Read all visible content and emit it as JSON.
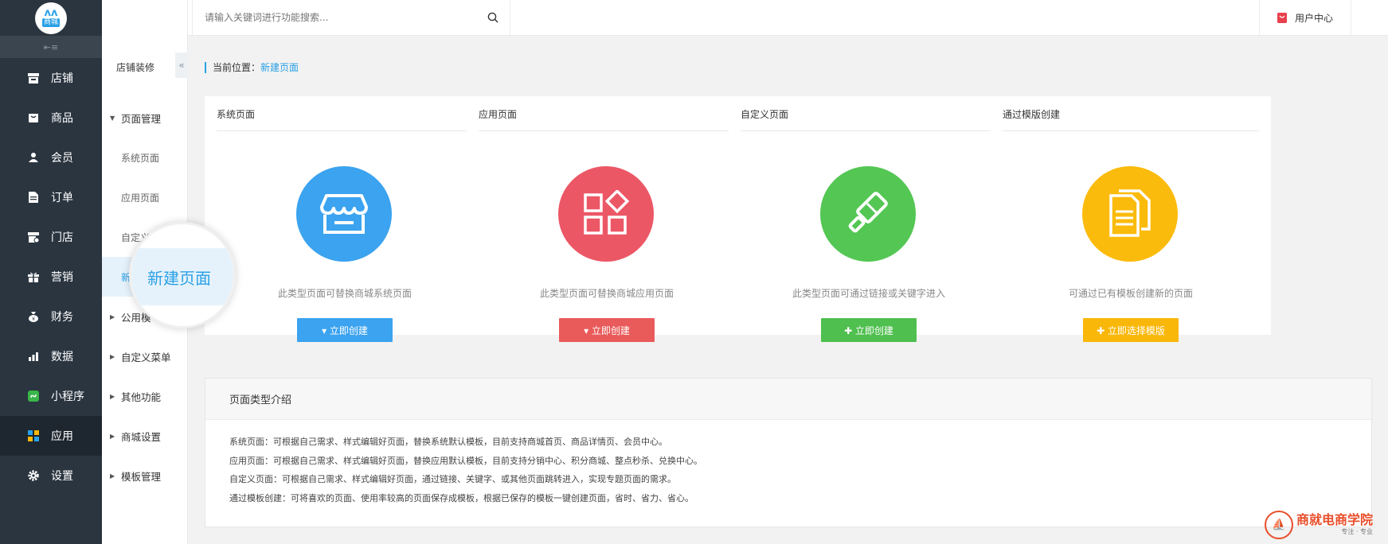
{
  "logo": {
    "mark": "ʌʌ",
    "text": "商城"
  },
  "sidebar": {
    "items": [
      {
        "label": "店铺",
        "icon": "store-icon"
      },
      {
        "label": "商品",
        "icon": "bag-icon"
      },
      {
        "label": "会员",
        "icon": "user-icon"
      },
      {
        "label": "订单",
        "icon": "document-icon"
      },
      {
        "label": "门店",
        "icon": "shop-icon"
      },
      {
        "label": "营销",
        "icon": "gift-icon"
      },
      {
        "label": "财务",
        "icon": "money-bag-icon"
      },
      {
        "label": "数据",
        "icon": "chart-icon"
      },
      {
        "label": "小程序",
        "icon": "miniprogram-icon"
      },
      {
        "label": "应用",
        "icon": "apps-icon",
        "active": true
      },
      {
        "label": "设置",
        "icon": "gear-icon"
      }
    ]
  },
  "subnav": {
    "title": "店铺装修",
    "page_management": "页面管理",
    "items": [
      "系统页面",
      "应用页面",
      "自定义",
      "新"
    ],
    "public": "公用模",
    "custom_menu": "自定义菜单",
    "other": "其他功能",
    "mall_settings": "商城设置",
    "template_mgmt": "模板管理"
  },
  "magnifier_text": "新建页面",
  "topbar": {
    "search_placeholder": "请输入关键词进行功能搜索...",
    "user_center": "用户中心"
  },
  "breadcrumb": {
    "prefix": "当前位置：",
    "current": "新建页面"
  },
  "cards": [
    {
      "title": "系统页面",
      "desc": "此类型页面可替换商城系统页面",
      "button": "▾ 立即创建",
      "color": "#3ba3ef",
      "btn_color": "#3ba3ef"
    },
    {
      "title": "应用页面",
      "desc": "此类型页面可替换商城应用页面",
      "button": "▾ 立即创建",
      "color": "#ec5766",
      "btn_color": "#e95a5a"
    },
    {
      "title": "自定义页面",
      "desc": "此类型页面可通过链接或关键字进入",
      "button": "✚ 立即创建",
      "color": "#53c653",
      "btn_color": "#4fbf4f"
    },
    {
      "title": "通过模版创建",
      "desc": "可通过已有模板创建新的页面",
      "button": "✚ 立即选择模版",
      "color": "#fbbb0c",
      "btn_color": "#f9b709"
    }
  ],
  "intro": {
    "title": "页面类型介绍",
    "lines": [
      "系统页面：可根据自己需求、样式编辑好页面，替换系统默认模板，目前支持商城首页、商品详情页、会员中心。",
      "应用页面：可根据自己需求、样式编辑好页面，替换应用默认模板，目前支持分销中心、积分商城、整点秒杀、兑换中心。",
      "自定义页面：可根据自己需求、样式编辑好页面，通过链接、关键字、或其他页面跳转进入，实现专题页面的需求。",
      "通过模板创建：可将喜欢的页面、使用率较高的页面保存成模板，根据已保存的模板一键创建页面，省时、省力、省心。"
    ]
  },
  "watermark": {
    "name": "商就电商学院",
    "tagline": "专注 · 专业"
  }
}
